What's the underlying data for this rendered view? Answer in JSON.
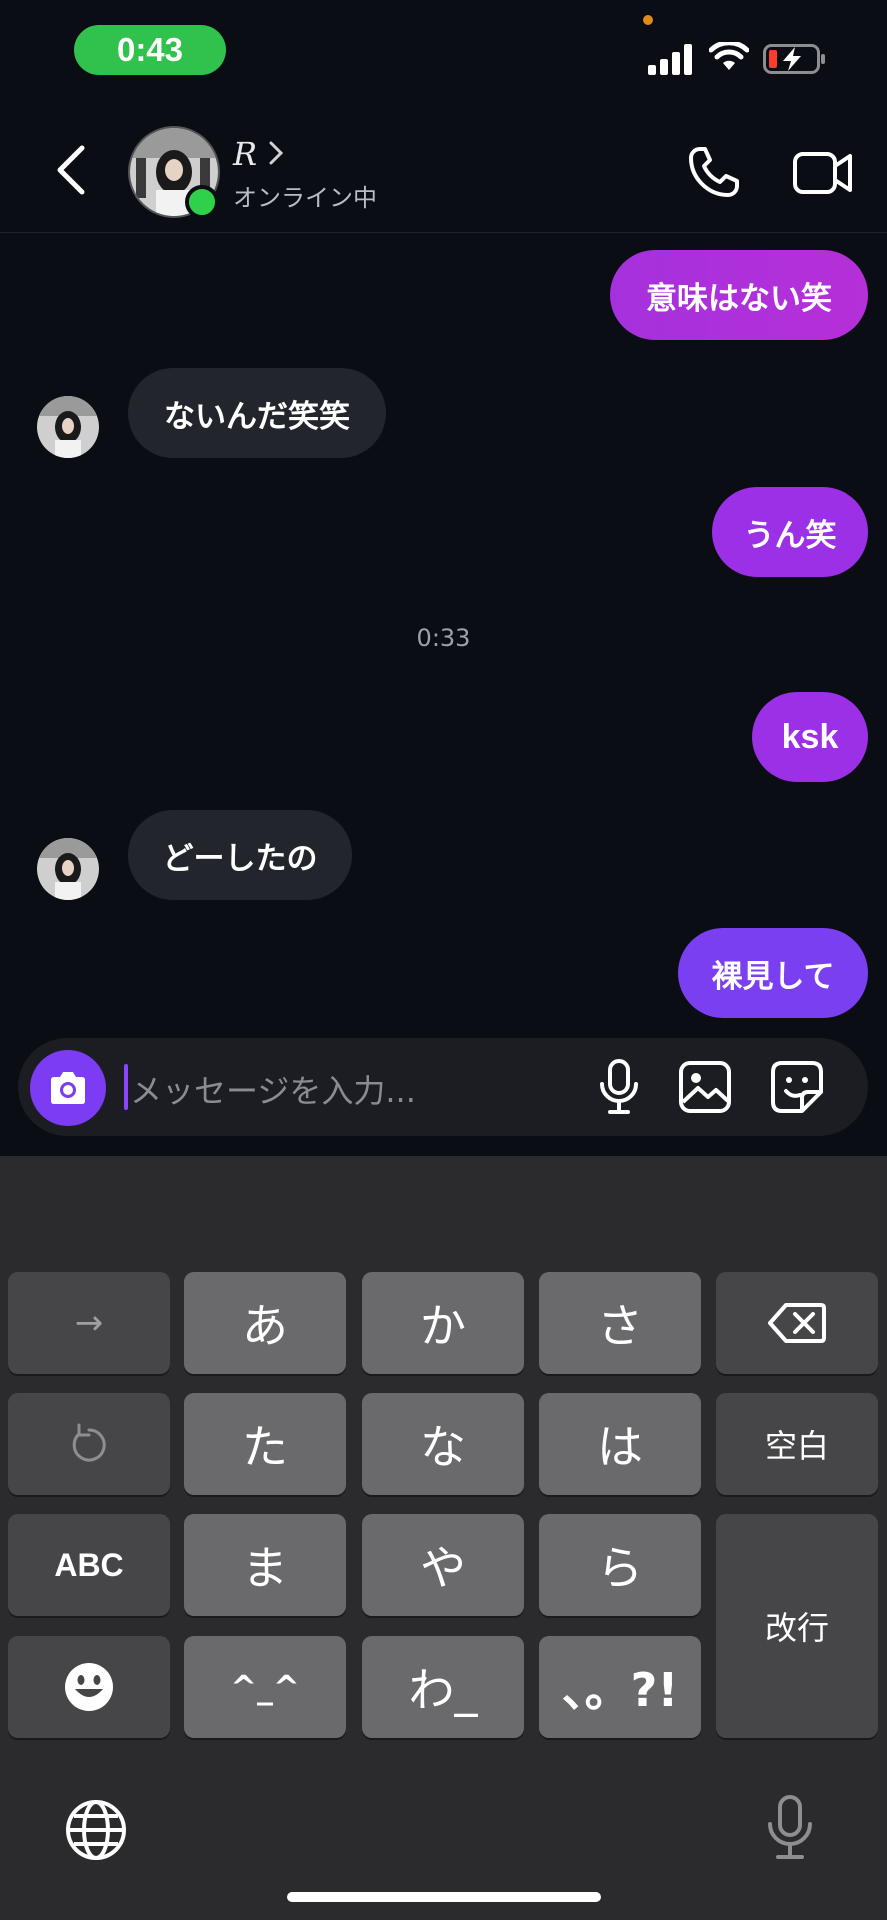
{
  "status_bar": {
    "time": "0:43"
  },
  "header": {
    "contact_name": "R",
    "contact_status": "オンライン中"
  },
  "messages": [
    {
      "direction": "out",
      "text": "意味はない笑"
    },
    {
      "direction": "in",
      "text": "ないんだ笑笑"
    },
    {
      "direction": "out",
      "text": "うん笑"
    },
    {
      "type": "timestamp",
      "text": "0:33"
    },
    {
      "direction": "out",
      "text": "ksk"
    },
    {
      "direction": "in",
      "text": "どーしたの"
    },
    {
      "direction": "out",
      "text": "裸見して"
    }
  ],
  "composer": {
    "placeholder": "メッセージを入力..."
  },
  "keyboard": {
    "row1": [
      "→",
      "あ",
      "か",
      "さ",
      "⌫"
    ],
    "row2": [
      "↺",
      "た",
      "な",
      "は",
      "空白"
    ],
    "row3": [
      "ABC",
      "ま",
      "や",
      "ら"
    ],
    "row4": [
      "☺",
      "^_^",
      "わ_",
      "、。?!"
    ],
    "enter": "改行"
  },
  "colors": {
    "background": "#0b0d14",
    "outgoing_bubble": "#9b30e6",
    "incoming_bubble": "#23252c",
    "accent": "#7b3cf4",
    "online": "#2fd14a"
  }
}
